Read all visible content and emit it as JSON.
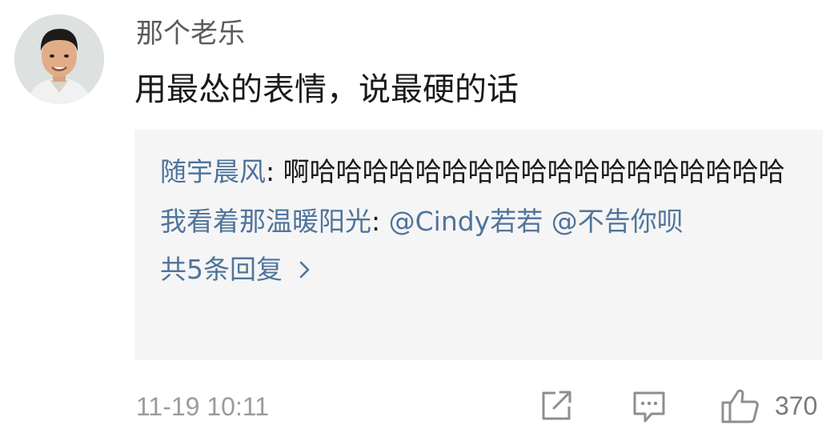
{
  "post": {
    "username": "那个老乐",
    "comment_text": "用最怂的表情，说最硬的话"
  },
  "replies": [
    {
      "user": "随宇晨风",
      "separator": ": ",
      "text": "啊哈哈哈哈哈哈哈哈哈哈哈哈哈哈哈哈哈哈"
    },
    {
      "user": "我看着那温暖阳光",
      "separator": ": ",
      "mentions": [
        "@Cindy若若",
        "@不告你呗"
      ]
    }
  ],
  "more_replies_label": "共5条回复",
  "footer": {
    "timestamp": "11-19 10:11",
    "like_count": "370"
  },
  "icons": {
    "repost": "repost-icon",
    "comment": "comment-icon",
    "like": "thumbs-up-icon",
    "more": "chevron-right-icon"
  },
  "colors": {
    "link_blue": "#50749b",
    "reply_background": "#f5f5f5",
    "meta_gray": "#9b9b9b"
  }
}
